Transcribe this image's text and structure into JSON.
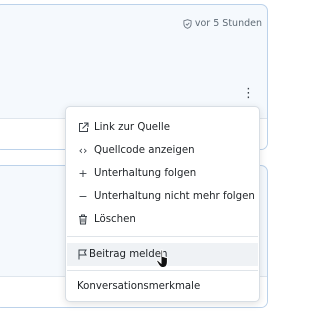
{
  "card1": {
    "timestamp": "vor 5 Stunden",
    "timestamp_icon": "shield-check-icon",
    "more_icon": "kebab-menu-icon"
  },
  "menu": {
    "items": [
      {
        "icon": "external-link-icon",
        "label": "Link zur Quelle"
      },
      {
        "icon": "code-icon",
        "glyph": "‹›",
        "label": "Quellcode anzeigen"
      },
      {
        "icon": "plus-icon",
        "glyph": "+",
        "label": "Unterhaltung folgen"
      },
      {
        "icon": "minus-icon",
        "glyph": "−",
        "label": "Unterhaltung nicht mehr folgen"
      },
      {
        "icon": "trash-icon",
        "label": "Löschen"
      }
    ],
    "report": {
      "icon": "flag-icon",
      "label": "Beitrag melden"
    },
    "features": {
      "label": "Konversationsmerkmale"
    }
  },
  "colors": {
    "card_border": "#bcd2ea",
    "card_bg": "#f5f9fd",
    "hover_bg": "#eff2f5"
  }
}
